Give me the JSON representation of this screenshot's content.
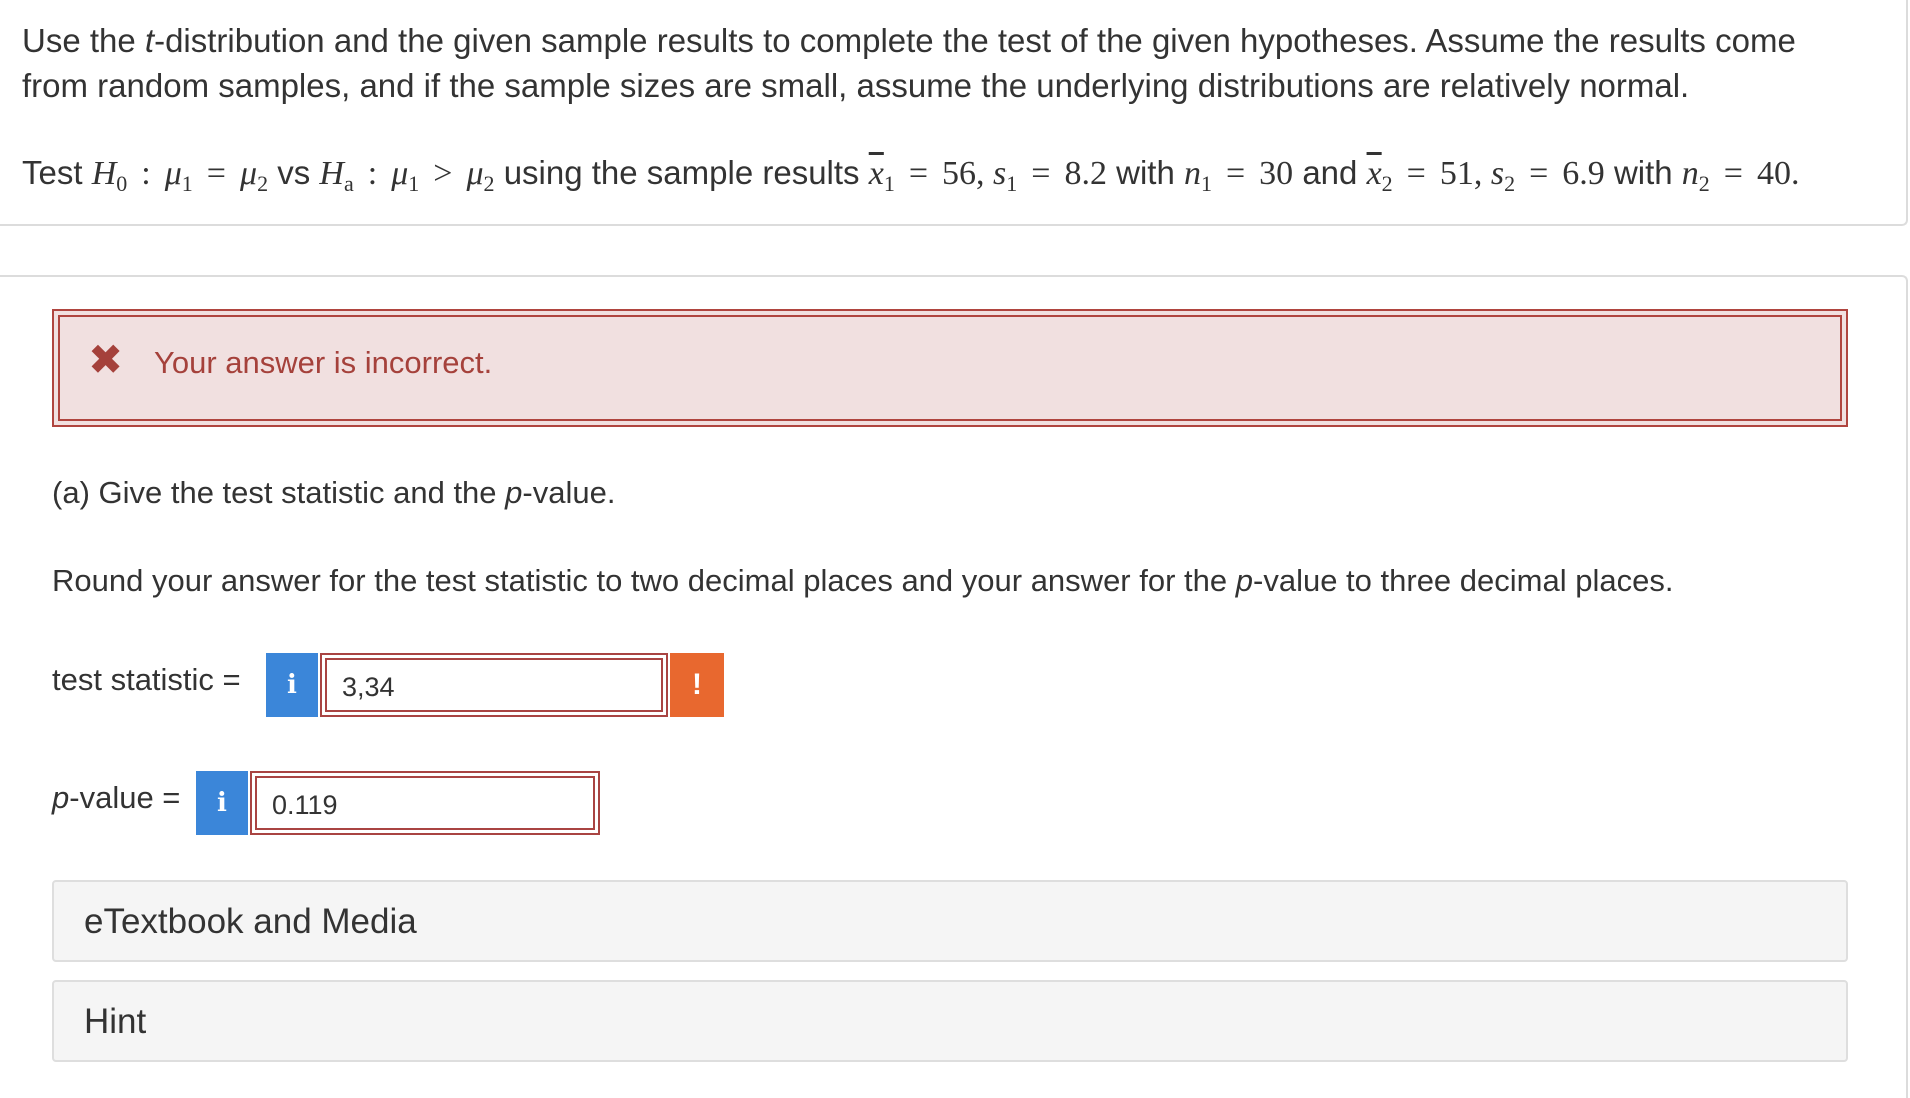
{
  "question": {
    "intro_prefix": "Use the ",
    "intro_t": "t",
    "intro_rest": "-distribution and the given sample results to complete the test of the given hypotheses. Assume the results come from random samples, and if the sample sizes are small, assume the underlying distributions are relatively normal.",
    "test_word": "Test",
    "vs_word": "vs",
    "using_text": "using the sample results",
    "with_word": "with",
    "and_word": "and",
    "H0": "H",
    "H0_sub": "0",
    "Ha": "H",
    "Ha_sub": "a",
    "mu": "μ",
    "sub1": "1",
    "sub2": "2",
    "x_bar": "x",
    "s": "s",
    "n": "n",
    "eq": "=",
    "gt": ">",
    "colon": ":",
    "x1_val": "56,",
    "s1_val": "8.2",
    "n1_val": "30",
    "x2_val": "51,",
    "s2_val": "6.9",
    "n2_val": "40."
  },
  "feedback": {
    "icon": "✖",
    "message": "Your answer is incorrect."
  },
  "part_a": {
    "label_pre": "(a) Give the test statistic and the ",
    "label_p": "p",
    "label_post": "-value.",
    "instruction_pre": "Round your answer for the test statistic to two decimal places and your answer for the ",
    "instruction_p": "p",
    "instruction_post": "-value to three decimal places."
  },
  "fields": {
    "test_statistic_label": "test statistic =",
    "test_statistic_value": "3,34",
    "p_label_p": "p",
    "p_label_rest": "-value =",
    "p_value": "0.119",
    "info_glyph": "i",
    "warn_glyph": "!"
  },
  "panels": {
    "etextbook": "eTextbook and Media",
    "hint": "Hint"
  },
  "colors": {
    "error_red": "#a94442",
    "error_bg": "#f1e0e0",
    "info_blue": "#3b86d9",
    "warn_orange": "#e8682f"
  }
}
